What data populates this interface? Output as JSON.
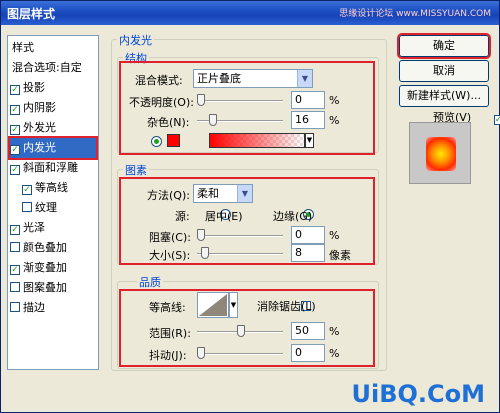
{
  "window": {
    "title": "图层样式",
    "watermark": "思缘设计论坛 www.MISSYUAN.COM"
  },
  "sidebar": {
    "items": [
      {
        "label": "样式",
        "checkbox": false,
        "checked": false
      },
      {
        "label": "混合选项:自定",
        "checkbox": false,
        "checked": false
      },
      {
        "label": "投影",
        "checkbox": true,
        "checked": true
      },
      {
        "label": "内阴影",
        "checkbox": true,
        "checked": true
      },
      {
        "label": "外发光",
        "checkbox": true,
        "checked": true
      },
      {
        "label": "内发光",
        "checkbox": true,
        "checked": true,
        "selected": true
      },
      {
        "label": "斜面和浮雕",
        "checkbox": true,
        "checked": true
      },
      {
        "label": "等高线",
        "checkbox": true,
        "checked": true,
        "indent": true
      },
      {
        "label": "纹理",
        "checkbox": true,
        "checked": false,
        "indent": true
      },
      {
        "label": "光泽",
        "checkbox": true,
        "checked": true
      },
      {
        "label": "颜色叠加",
        "checkbox": true,
        "checked": false
      },
      {
        "label": "渐变叠加",
        "checkbox": true,
        "checked": true
      },
      {
        "label": "图案叠加",
        "checkbox": true,
        "checked": false
      },
      {
        "label": "描边",
        "checkbox": true,
        "checked": false
      }
    ]
  },
  "main": {
    "section_title": "内发光",
    "structure": {
      "title": "结构",
      "blend_mode_label": "混合模式:",
      "blend_mode_value": "正片叠底",
      "opacity_label": "不透明度(O):",
      "opacity_value": "0",
      "opacity_unit": "%",
      "noise_label": "杂色(N):",
      "noise_value": "16",
      "noise_unit": "%",
      "opacity_fraction": 0.0,
      "noise_fraction": 0.16
    },
    "elements": {
      "title": "图素",
      "method_label": "方法(Q):",
      "method_value": "柔和",
      "source_label": "源:",
      "source_center": "居中(E)",
      "source_edge": "边缘(G)",
      "choke_label": "阻塞(C):",
      "choke_value": "0",
      "choke_unit": "%",
      "size_label": "大小(S):",
      "size_value": "8",
      "size_unit": "像素"
    },
    "quality": {
      "title": "品质",
      "contour_label": "等高线:",
      "antialias_label": "消除锯齿(L)",
      "range_label": "范围(R):",
      "range_value": "50",
      "range_unit": "%",
      "jitter_label": "抖动(J):",
      "jitter_value": "0",
      "jitter_unit": "%"
    }
  },
  "buttons": {
    "ok": "确定",
    "cancel": "取消",
    "new_style": "新建样式(W)...",
    "preview_label": "预览(V)"
  },
  "brand_logo": "UiBQ.CoM",
  "colors": {
    "glow_color": "#ff0000",
    "accent_red": "#e0202a",
    "title_blue": "#0046d5"
  }
}
